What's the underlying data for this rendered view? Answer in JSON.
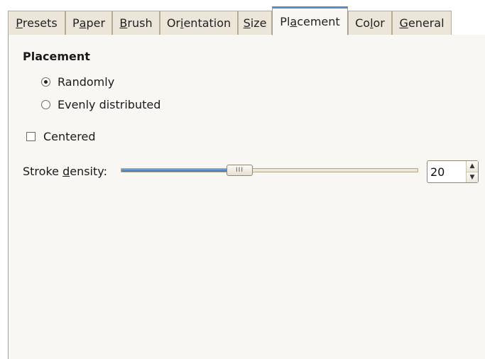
{
  "tabs": [
    {
      "pre": "",
      "mn": "P",
      "post": "resets"
    },
    {
      "pre": "P",
      "mn": "a",
      "post": "per"
    },
    {
      "pre": "",
      "mn": "B",
      "post": "rush"
    },
    {
      "pre": "Or",
      "mn": "i",
      "post": "entation"
    },
    {
      "pre": "",
      "mn": "S",
      "post": "ize"
    },
    {
      "pre": "Pl",
      "mn": "a",
      "post": "cement"
    },
    {
      "pre": "Co",
      "mn": "l",
      "post": "or"
    },
    {
      "pre": "",
      "mn": "G",
      "post": "eneral"
    }
  ],
  "active_tab": "Placement",
  "placement": {
    "title": "Placement",
    "option_randomly": "Randomly",
    "option_evenly": "Evenly distributed",
    "selected": "Randomly",
    "centered_label": "Centered",
    "centered_checked": false
  },
  "stroke_density": {
    "label_pre": "Stroke ",
    "label_mn": "d",
    "label_post": "ensity:",
    "value": "20",
    "min": 1,
    "max": 50,
    "knob_grip": "III",
    "spin_up": "▲",
    "spin_down": "▼"
  },
  "colors": {
    "accent": "#5b8ac7",
    "panel": "#f8f7f3",
    "tab": "#ebe6d9"
  }
}
